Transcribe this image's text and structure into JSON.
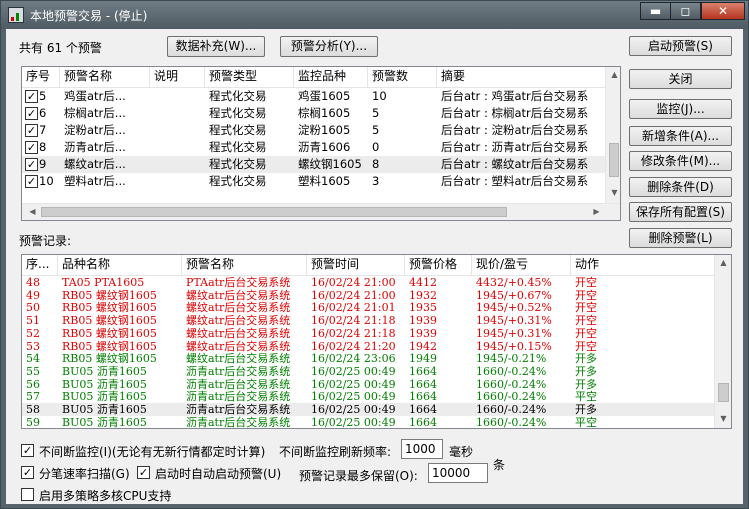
{
  "window": {
    "title": "本地预警交易 - (停止)",
    "min_label": "▬",
    "max_label": "◻",
    "close_label": "✕"
  },
  "header": {
    "count_label": "共有 61 个预警",
    "data_fill_button": "数据补充(W)...",
    "analysis_button": "预警分析(Y)..."
  },
  "side_buttons": {
    "start": "启动预警(S)",
    "close": "关闭",
    "monitor": "监控(J)...",
    "add_condition": "新增条件(A)...",
    "edit_condition": "修改条件(M)...",
    "delete_condition": "删除条件(D)",
    "save_all": "保存所有配置(S)",
    "delete_alert": "删除预警(L)"
  },
  "alerts_table": {
    "columns": [
      "序号",
      "预警名称",
      "说明",
      "预警类型",
      "监控品种",
      "预警数",
      "摘要"
    ],
    "rows": [
      {
        "no": "5",
        "name": "鸡蛋atr后...",
        "desc": "",
        "type": "程式化交易",
        "symbol": "鸡蛋1605",
        "count": "10",
        "summary": "后台atr : 鸡蛋atr后台交易系"
      },
      {
        "no": "6",
        "name": "棕榈atr后...",
        "desc": "",
        "type": "程式化交易",
        "symbol": "棕榈1605",
        "count": "5",
        "summary": "后台atr : 棕榈atr后台交易系"
      },
      {
        "no": "7",
        "name": "淀粉atr后...",
        "desc": "",
        "type": "程式化交易",
        "symbol": "淀粉1605",
        "count": "5",
        "summary": "后台atr : 淀粉atr后台交易系"
      },
      {
        "no": "8",
        "name": "沥青atr后...",
        "desc": "",
        "type": "程式化交易",
        "symbol": "沥青1606",
        "count": "0",
        "summary": "后台atr : 沥青atr后台交易系"
      },
      {
        "no": "9",
        "name": "螺纹atr后...",
        "desc": "",
        "type": "程式化交易",
        "symbol": "螺纹钢1605",
        "count": "8",
        "summary": "后台atr : 螺纹atr后台交易系"
      },
      {
        "no": "10",
        "name": "塑料atr后...",
        "desc": "",
        "type": "程式化交易",
        "symbol": "塑料1605",
        "count": "3",
        "summary": "后台atr : 塑料atr后台交易系"
      }
    ]
  },
  "records_label": "预警记录:",
  "records_table": {
    "columns": [
      "序...",
      "品种名称",
      "预警名称",
      "预警时间",
      "预警价格",
      "现价/盈亏",
      "动作"
    ],
    "rows": [
      {
        "no": "48",
        "symbol": "TA05 PTA1605",
        "name": "PTAatr后台交易系统",
        "time": "16/02/24 21:00",
        "price": "4412",
        "pl": "4432/+0.45%",
        "action": "开空",
        "color": "#e00000"
      },
      {
        "no": "49",
        "symbol": "RB05 螺纹钢1605",
        "name": "螺纹atr后台交易系统",
        "time": "16/02/24 21:00",
        "price": "1932",
        "pl": "1945/+0.67%",
        "action": "开空",
        "color": "#e00000"
      },
      {
        "no": "50",
        "symbol": "RB05 螺纹钢1605",
        "name": "螺纹atr后台交易系统",
        "time": "16/02/24 21:01",
        "price": "1935",
        "pl": "1945/+0.52%",
        "action": "开空",
        "color": "#e00000"
      },
      {
        "no": "51",
        "symbol": "RB05 螺纹钢1605",
        "name": "螺纹atr后台交易系统",
        "time": "16/02/24 21:18",
        "price": "1939",
        "pl": "1945/+0.31%",
        "action": "开空",
        "color": "#e00000"
      },
      {
        "no": "52",
        "symbol": "RB05 螺纹钢1605",
        "name": "螺纹atr后台交易系统",
        "time": "16/02/24 21:18",
        "price": "1939",
        "pl": "1945/+0.31%",
        "action": "开空",
        "color": "#e00000"
      },
      {
        "no": "53",
        "symbol": "RB05 螺纹钢1605",
        "name": "螺纹atr后台交易系统",
        "time": "16/02/24 21:20",
        "price": "1942",
        "pl": "1945/+0.15%",
        "action": "开空",
        "color": "#e00000"
      },
      {
        "no": "54",
        "symbol": "RB05 螺纹钢1605",
        "name": "螺纹atr后台交易系统",
        "time": "16/02/24 23:06",
        "price": "1949",
        "pl": "1945/-0.21%",
        "action": "开多",
        "color": "#008000"
      },
      {
        "no": "55",
        "symbol": "BU05 沥青1605",
        "name": "沥青atr后台交易系统",
        "time": "16/02/25 00:49",
        "price": "1664",
        "pl": "1660/-0.24%",
        "action": "开多",
        "color": "#008000"
      },
      {
        "no": "56",
        "symbol": "BU05 沥青1605",
        "name": "沥青atr后台交易系统",
        "time": "16/02/25 00:49",
        "price": "1664",
        "pl": "1660/-0.24%",
        "action": "开多",
        "color": "#008000"
      },
      {
        "no": "57",
        "symbol": "BU05 沥青1605",
        "name": "沥青atr后台交易系统",
        "time": "16/02/25 00:49",
        "price": "1664",
        "pl": "1660/-0.24%",
        "action": "平空",
        "color": "#008000"
      },
      {
        "no": "58",
        "symbol": "BU05 沥青1605",
        "name": "沥青atr后台交易系统",
        "time": "16/02/25 00:49",
        "price": "1664",
        "pl": "1660/-0.24%",
        "action": "开多",
        "color": "#000000"
      },
      {
        "no": "59",
        "symbol": "BU05 沥青1605",
        "name": "沥青atr后台交易系统",
        "time": "16/02/25 00:49",
        "price": "1664",
        "pl": "1660/-0.24%",
        "action": "平空",
        "color": "#008000"
      }
    ]
  },
  "options": {
    "continuous_monitor_label": "不间断监控(I)(无论有无新行情都定时计算)",
    "refresh_label": "不间断监控刷新频率:",
    "refresh_value": "1000",
    "refresh_unit": "毫秒",
    "minute_scan_label": "分笔速率扫描(G)",
    "auto_start_label": "启动时自动启动预警(U)",
    "max_records_label": "预警记录最多保留(O):",
    "max_records_value": "10000",
    "max_records_unit": "条",
    "multicore_label": "启用多策略多核CPU支持"
  }
}
